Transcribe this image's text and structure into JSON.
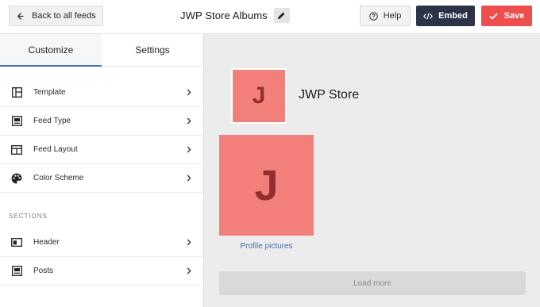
{
  "header": {
    "back_label": "Back to all feeds",
    "feed_title": "JWP Store Albums",
    "help_label": "Help",
    "embed_label": "Embed",
    "save_label": "Save"
  },
  "sidebar": {
    "tabs": [
      {
        "label": "Customize",
        "active": true
      },
      {
        "label": "Settings",
        "active": false
      }
    ],
    "items": [
      {
        "label": "Template",
        "icon": "template-icon"
      },
      {
        "label": "Feed Type",
        "icon": "feed-type-icon"
      },
      {
        "label": "Feed Layout",
        "icon": "feed-layout-icon"
      },
      {
        "label": "Color Scheme",
        "icon": "palette-icon"
      }
    ],
    "sections_label": "SECTIONS",
    "section_items": [
      {
        "label": "Header",
        "icon": "header-icon"
      },
      {
        "label": "Posts",
        "icon": "posts-icon"
      }
    ]
  },
  "preview": {
    "avatar_letter": "J",
    "store_name": "JWP Store",
    "post_letter": "J",
    "post_caption": "Profile pictures",
    "load_more_label": "Load more"
  },
  "colors": {
    "accent_dark": "#2c3349",
    "save_red": "#ef4e4e",
    "tile_pink": "#f27f7a",
    "tile_letter": "#922e30",
    "link_blue": "#4a6ea8",
    "tab_underline": "#3d74c9"
  }
}
